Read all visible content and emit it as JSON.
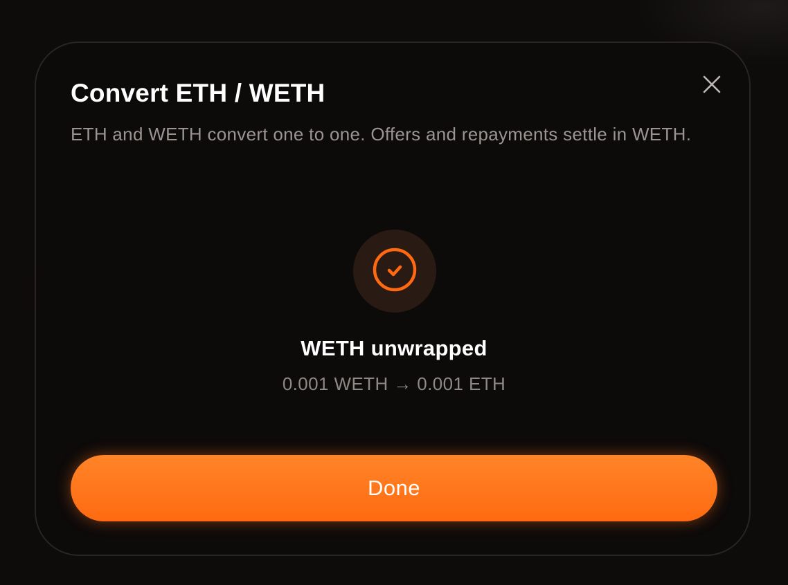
{
  "modal": {
    "title": "Convert ETH / WETH",
    "subtitle": "ETH and WETH convert one to one. Offers and repayments settle in WETH.",
    "close_icon": "close-icon"
  },
  "status": {
    "icon": "check-circle-icon",
    "title": "WETH unwrapped",
    "detail": "0.001 WETH → 0.001 ETH"
  },
  "actions": {
    "done_label": "Done"
  },
  "colors": {
    "accent": "#ff6a10",
    "background": "#0d0a0a",
    "border": "#2a2524",
    "icon_bg": "#2a1a14",
    "muted_text": "#9b9492"
  }
}
